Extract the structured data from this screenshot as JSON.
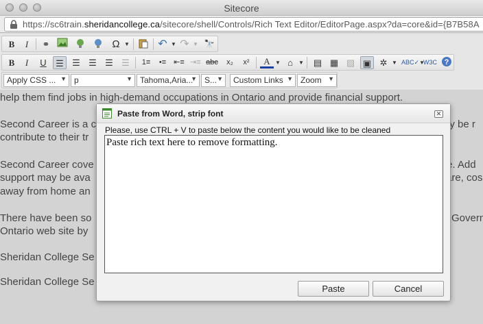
{
  "window": {
    "title": "Sitecore"
  },
  "address_bar": {
    "protocol_prefix": "https://sc6train.",
    "host_bold": "sheridancollege.ca",
    "path": "/sitecore/shell/Controls/Rich Text Editor/EditorPage.aspx?da=core&id={B7B58A"
  },
  "toolbar": {
    "row1_icons": [
      "bold-icon",
      "italic-icon",
      "link-icon",
      "image-icon",
      "media-icon",
      "flash-icon",
      "symbol-omega-icon",
      "paste-icon",
      "undo-icon",
      "redo-icon",
      "find-replace-icon"
    ],
    "row2_icons": [
      "bold-icon",
      "italic-icon",
      "underline-icon",
      "align-left-icon",
      "align-center-icon",
      "align-right-icon",
      "justify-icon",
      "indent-icon",
      "numbered-list-icon",
      "bulleted-list-icon",
      "outdent-icon",
      "increase-indent-icon",
      "strikethrough-icon",
      "subscript-icon",
      "superscript-icon",
      "font-color-icon",
      "highlight-icon",
      "horizontal-rule-icon",
      "table-icon",
      "image-properties-icon",
      "format-stripper-icon",
      "spell-check-icon",
      "w3c-validator-icon",
      "help-icon"
    ],
    "css_class_label": "Apply CSS ...",
    "paragraph_label": "p",
    "font_name_label": "Tahoma,Aria...",
    "font_size_label": "S...",
    "custom_links_label": "Custom Links",
    "zoom_label": "Zoom"
  },
  "content": {
    "p1": "help them find jobs in high-demand occupations in Ontario and provide financial support.",
    "p2a_left": "Second Career is a c",
    "p2a_right": "ay be r",
    "p2b_left": "contribute to their tr",
    "p3a_left": "Second Career cove",
    "p3a_right": "e.  Add",
    "p3b_left": "support may be ava",
    "p3b_right": "are, cos",
    "p3c_left": "away from home an",
    "p4a_left": "There have been so",
    "p4a_right": "Govern",
    "p4b_left": "Ontario web site by",
    "p5_left": "Sheridan College Se",
    "p6_left": "Sheridan College Se"
  },
  "dialog": {
    "title": "Paste from Word, strip font",
    "hint": "Please, use CTRL + V to paste below the content you would like to be cleaned",
    "placeholder_text": "Paste rich text here to remove formatting.",
    "paste_label": "Paste",
    "cancel_label": "Cancel"
  }
}
